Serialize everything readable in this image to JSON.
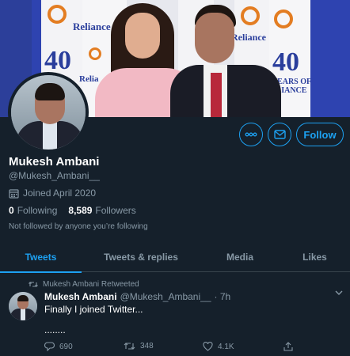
{
  "banner": {
    "brand_text_left": "Reliance",
    "brand_text_small": "Relia",
    "brand_text_right": "Reliance",
    "logo_number": "40",
    "years_text_right": "YEARS OF\nLIANCE"
  },
  "profile": {
    "name": "Mukesh Ambani",
    "handle": "@Mukesh_Ambani__",
    "joined": "Joined April 2020",
    "following_count": "0",
    "following_label": "Following",
    "followers_count": "8,589",
    "followers_label": "Followers",
    "not_followed": "Not followed by anyone you’re following"
  },
  "actions": {
    "more_icon": "more-icon",
    "message_icon": "mail-icon",
    "follow_label": "Follow"
  },
  "tabs": [
    {
      "label": "Tweets"
    },
    {
      "label": "Tweets & replies"
    },
    {
      "label": "Media"
    },
    {
      "label": "Likes"
    }
  ],
  "tweet": {
    "retweet_label": "Mukesh Ambani Retweeted",
    "author_name": "Mukesh Ambani",
    "author_handle": "@Mukesh_Ambani__",
    "time": "· 7h",
    "text_line1": "Finally I joined Twitter...",
    "text_line2": "........",
    "reply_count": "690",
    "retweet_count": "348",
    "like_count": "4.1K"
  },
  "colors": {
    "background": "#15202b",
    "accent": "#1da1f2",
    "secondary_text": "#8899a6",
    "divider": "#38444d"
  }
}
